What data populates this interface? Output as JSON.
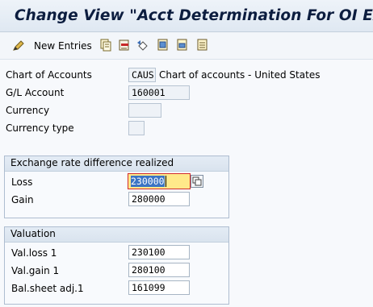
{
  "window": {
    "title": "Change View \"Acct Determination For OI Exch.Rate D"
  },
  "toolbar": {
    "new_entries_label": "New Entries",
    "icons": [
      "edit-pencil-icon",
      "copy-icon",
      "delete-icon",
      "undo-icon",
      "select-all-icon",
      "select-block-icon",
      "deselect-all-icon"
    ]
  },
  "header_fields": {
    "chart_of_accounts": {
      "label": "Chart of Accounts",
      "value": "CAUS",
      "description": "Chart of accounts - United States"
    },
    "gl_account": {
      "label": "G/L Account",
      "value": "160001"
    },
    "currency": {
      "label": "Currency",
      "value": ""
    },
    "currency_type": {
      "label": "Currency type",
      "value": ""
    }
  },
  "realized_group": {
    "title": "Exchange rate difference realized",
    "loss": {
      "label": "Loss",
      "value": "230000"
    },
    "gain": {
      "label": "Gain",
      "value": "280000"
    }
  },
  "valuation_group": {
    "title": "Valuation",
    "val_loss": {
      "label": "Val.loss 1",
      "value": "230100"
    },
    "val_gain": {
      "label": "Val.gain 1",
      "value": "280100"
    },
    "bal_sheet_adj": {
      "label": "Bal.sheet adj.1",
      "value": "161099"
    }
  },
  "colors": {
    "title_text": "#0c1d3f",
    "focus_field": "#ffe98a",
    "focus_border": "#d12a2a"
  }
}
